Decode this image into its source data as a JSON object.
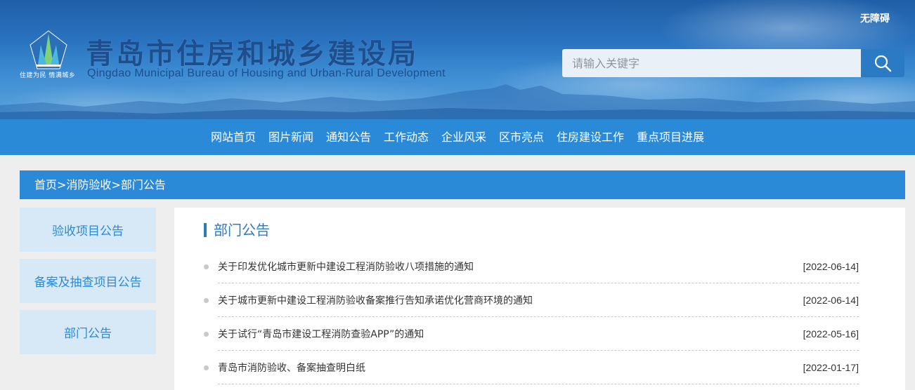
{
  "header": {
    "accessibility": "无障碍",
    "slogan": "住建为民 情满城乡",
    "title": "青岛市住房和城乡建设局",
    "subtitle": "Qingdao Municipal Bureau of Housing and Urban-Rural Development",
    "search_placeholder": "请输入关键字",
    "search_icon": "search-icon"
  },
  "nav": {
    "items": [
      "网站首页",
      "图片新闻",
      "通知公告",
      "工作动态",
      "企业风采",
      "区市亮点",
      "住房建设工作",
      "重点项目进展"
    ]
  },
  "breadcrumb": {
    "home": "首页",
    "sep1": ">",
    "section": "消防验收",
    "sep2": ">",
    "current": "部门公告"
  },
  "sidebar": {
    "items": [
      "验收项目公告",
      "备案及抽查项目公告",
      "部门公告"
    ]
  },
  "main": {
    "title": "部门公告",
    "items": [
      {
        "title": "关于印发优化城市更新中建设工程消防验收八项措施的通知",
        "date": "[2022-06-14]"
      },
      {
        "title": "关于城市更新中建设工程消防验收备案推行告知承诺优化营商环境的通知",
        "date": "[2022-06-14]"
      },
      {
        "title": "关于试行“青岛市建设工程消防查验APP”的通知",
        "date": "[2022-05-16]"
      },
      {
        "title": "青岛市消防验收、备案抽查明白纸",
        "date": "[2022-01-17]"
      }
    ]
  },
  "colors": {
    "nav_blue": "#2a8ad8",
    "title_blue": "#1d4f8f",
    "sidebar_bg": "#d7e9f6",
    "page_bg": "#eeeeee"
  }
}
